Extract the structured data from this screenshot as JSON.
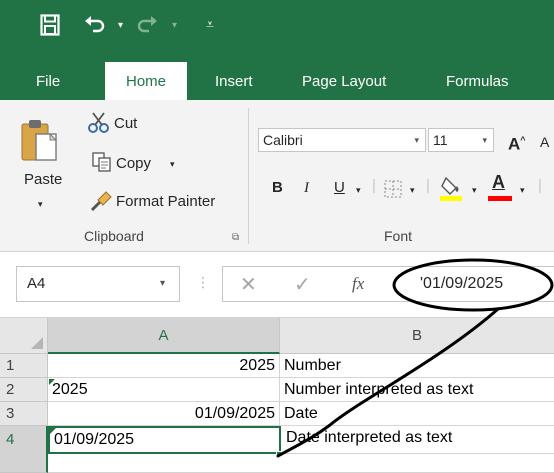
{
  "qat": {
    "save_icon": "save-icon",
    "undo_icon": "undo-icon",
    "redo_icon": "redo-icon",
    "customize_icon": "customize-qat-icon"
  },
  "tabs": [
    {
      "label": "File"
    },
    {
      "label": "Home"
    },
    {
      "label": "Insert"
    },
    {
      "label": "Page Layout"
    },
    {
      "label": "Formulas"
    }
  ],
  "clipboard": {
    "paste_label": "Paste",
    "cut_label": "Cut",
    "copy_label": "Copy",
    "format_painter_label": "Format Painter",
    "group_label": "Clipboard"
  },
  "font": {
    "font_name": "Calibri",
    "font_size": "11",
    "bold": "B",
    "italic": "I",
    "underline": "U",
    "grow_font": "A",
    "shrink_font": "A",
    "font_color": "A",
    "group_label": "Font",
    "highlight_color": "#ffff00",
    "text_color": "#ff0000"
  },
  "formula_bar": {
    "name_box": "A4",
    "cancel": "✕",
    "enter": "✓",
    "fx": "fx",
    "value": "'01/09/2025"
  },
  "grid": {
    "columns": [
      "A",
      "B"
    ],
    "rows": [
      {
        "num": "1",
        "a": "2025",
        "b": "Number"
      },
      {
        "num": "2",
        "a": "2025",
        "b": "Number interpreted as text"
      },
      {
        "num": "3",
        "a": "01/09/2025",
        "b": "Date"
      },
      {
        "num": "4",
        "a": "01/09/2025",
        "b": "Date interpreted as text"
      }
    ]
  },
  "colors": {
    "accent": "#217346",
    "annotation": "#000000"
  }
}
